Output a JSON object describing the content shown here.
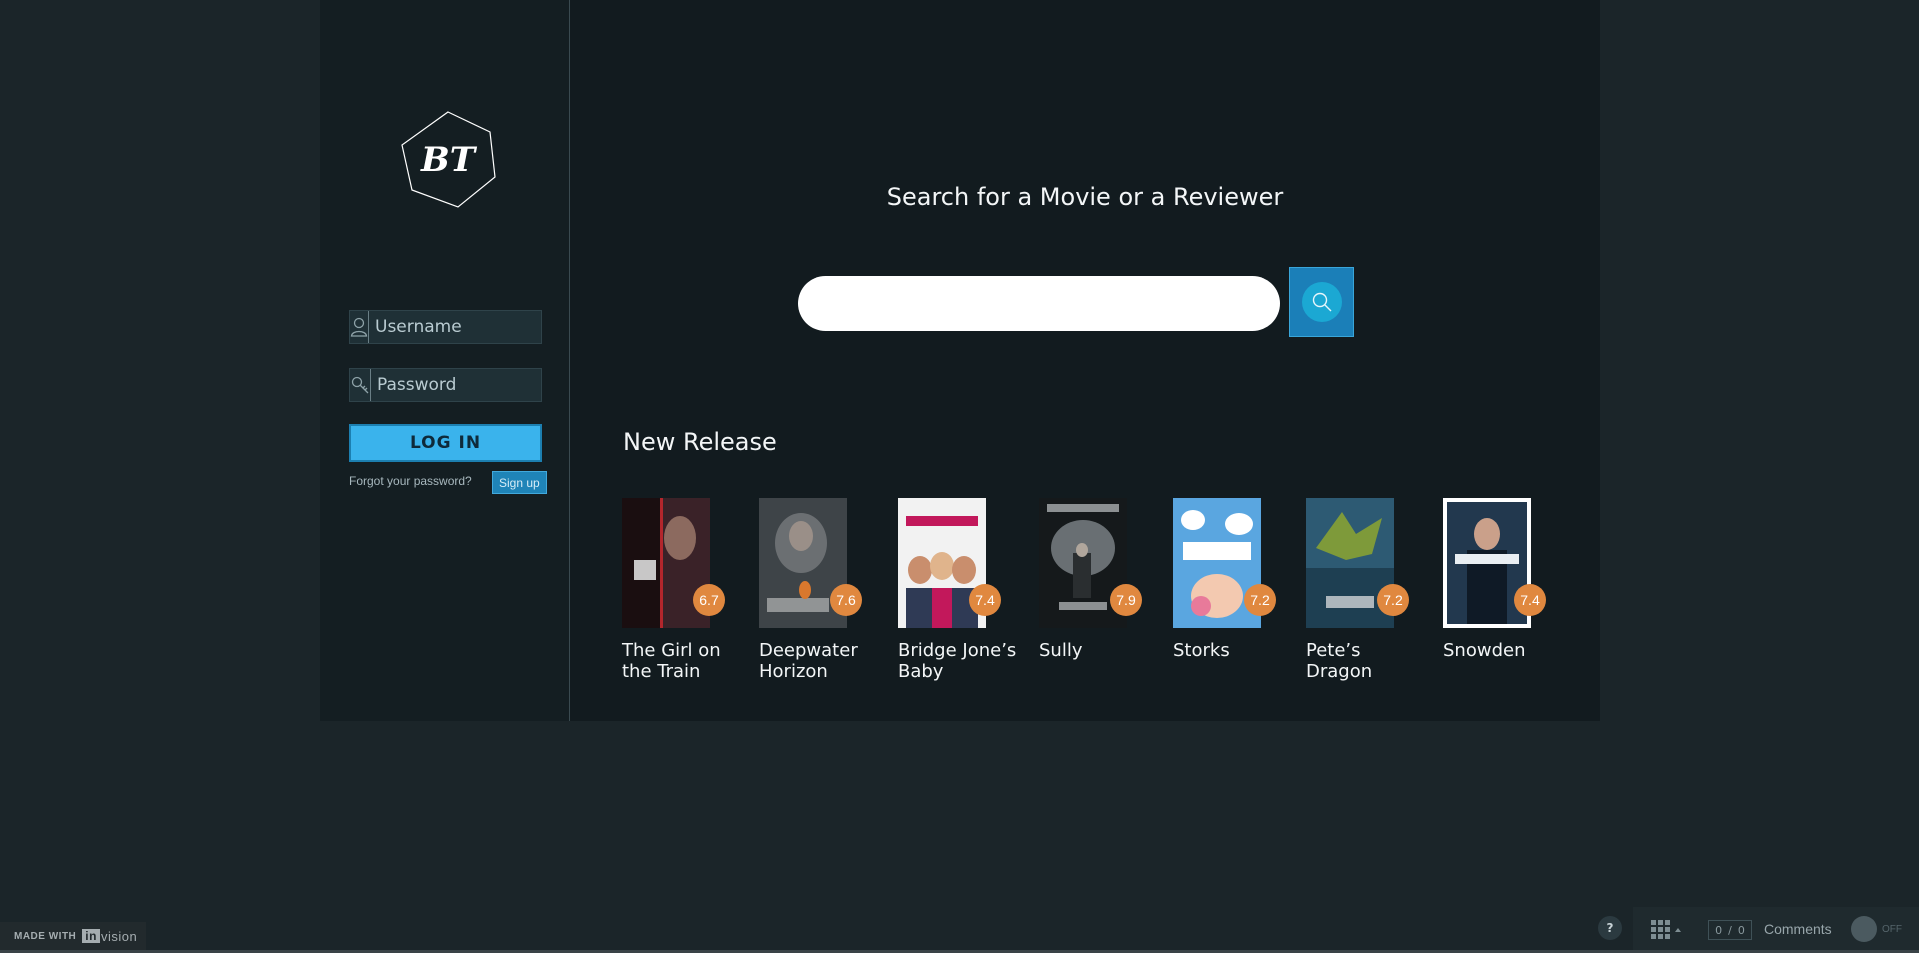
{
  "logo": {
    "text": "BT"
  },
  "login": {
    "username_placeholder": "Username",
    "password_placeholder": "Password",
    "login_label": "LOG IN",
    "forgot_label": "Forgot your password?",
    "signup_label": "Sign up"
  },
  "search": {
    "title": "Search for a Movie or a Reviewer",
    "placeholder": ""
  },
  "new_release": {
    "title": "New Release",
    "movies": [
      {
        "title": "The Girl on the Train",
        "rating": "6.7"
      },
      {
        "title": "Deepwater Horizon",
        "rating": "7.6"
      },
      {
        "title": "Bridge Jone’s Baby",
        "rating": "7.4"
      },
      {
        "title": "Sully",
        "rating": "7.9"
      },
      {
        "title": "Storks",
        "rating": "7.2"
      },
      {
        "title": "Pete’s Dragon",
        "rating": "7.2"
      },
      {
        "title": "Snowden",
        "rating": "7.4"
      }
    ]
  },
  "invision": {
    "made_with": "MADE WITH",
    "in": "in",
    "vision": "vision"
  },
  "toolbar": {
    "help": "?",
    "count_a": "0",
    "count_b": "0",
    "comments": "Comments",
    "toggle": "OFF"
  },
  "colors": {
    "background": "#1b2529",
    "panel": "#121b1f",
    "accent": "#3ab3ec",
    "rating": "#e0883f"
  }
}
